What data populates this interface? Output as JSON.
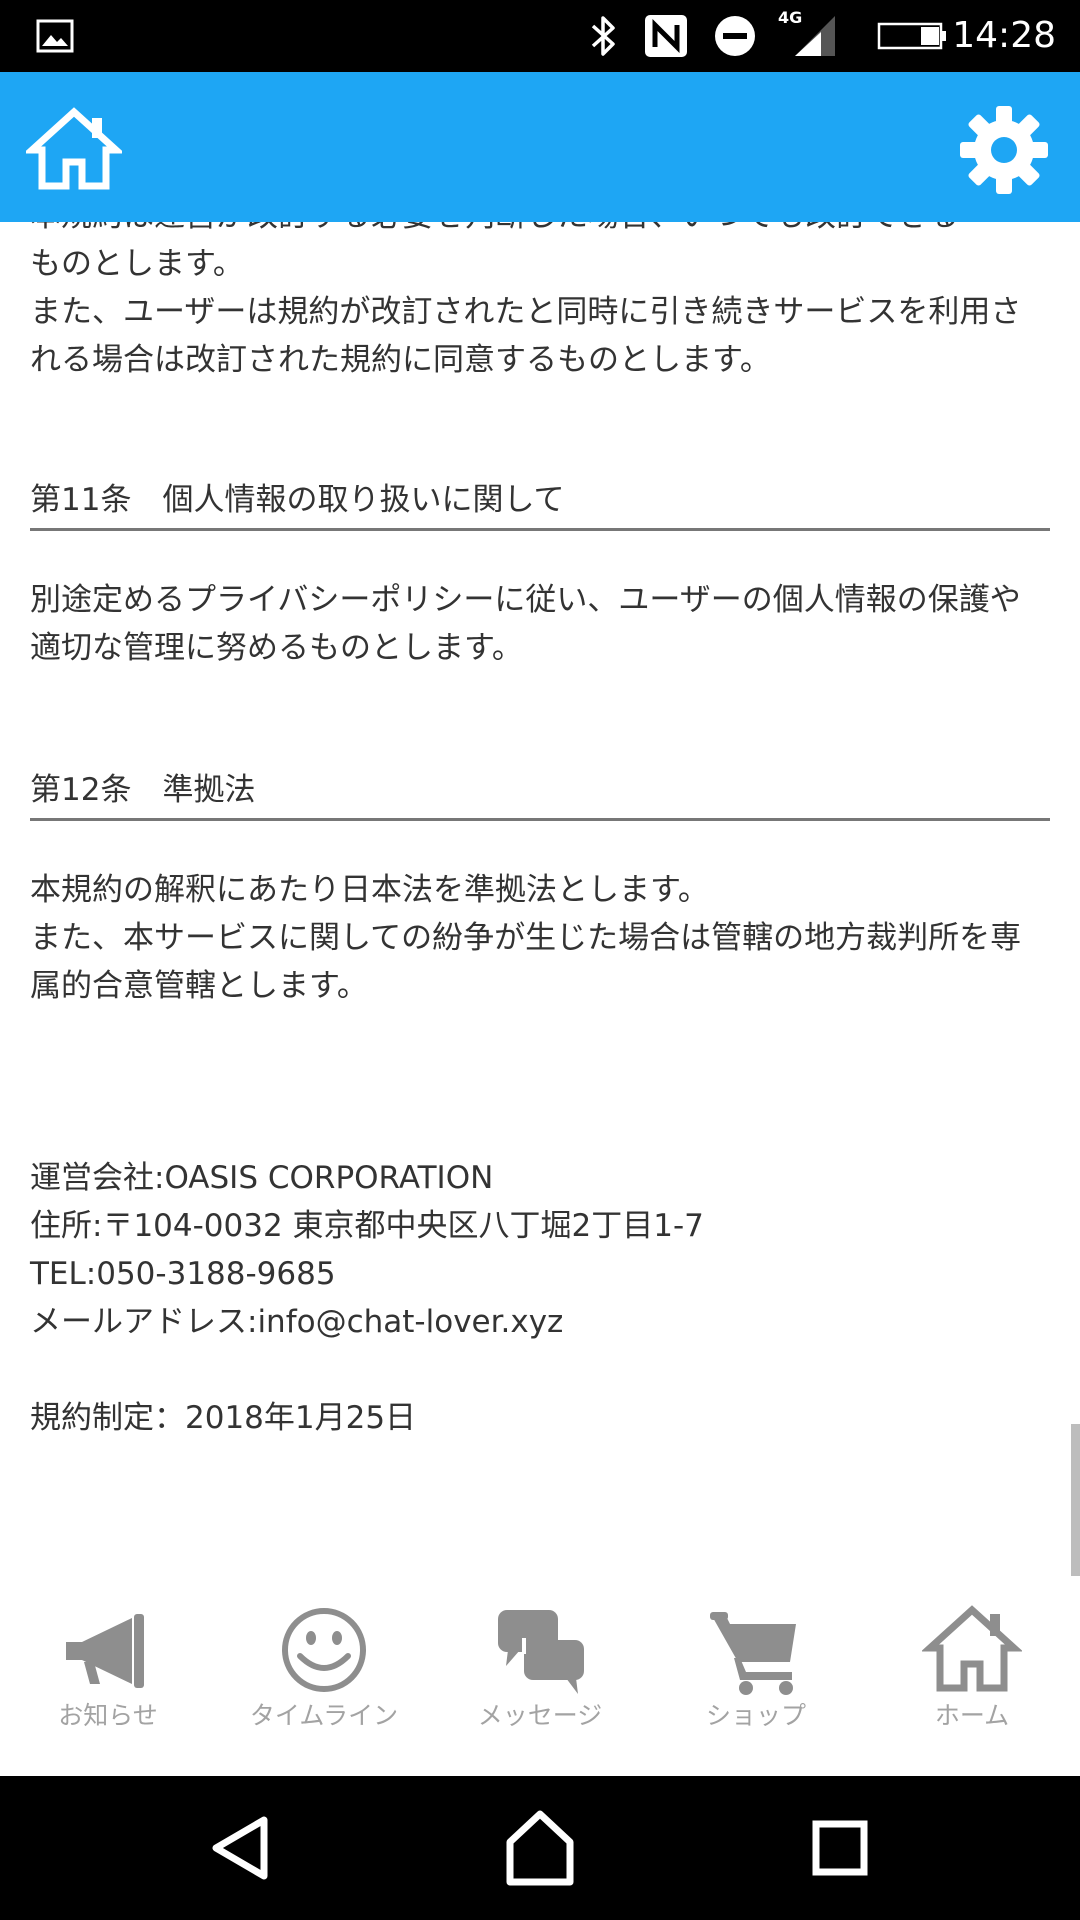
{
  "status_bar": {
    "time": "14:28",
    "network_label": "4G",
    "icons": [
      "image-icon",
      "bluetooth-icon",
      "nfc-icon",
      "do-not-disturb-icon",
      "signal-icon",
      "battery-icon"
    ]
  },
  "app_bar": {
    "background_color": "#1ea6f4",
    "left_icon": "home-icon",
    "right_icon": "gear-icon"
  },
  "content": {
    "cut_line": "本規約は運営が改訂する必要を判断した場合、いつでも改訂できる",
    "intro_paragraph": "ものとします。\nまた、ユーザーは規約が改訂されたと同時に引き続きサービスを利用される場合は改訂された規約に同意するものとします。",
    "article11": {
      "heading": "第11条　個人情報の取り扱いに関して",
      "body": "別途定めるプライバシーポリシーに従い、ユーザーの個人情報の保護や適切な管理に努めるものとします。"
    },
    "article12": {
      "heading": "第12条　準拠法",
      "body": "本規約の解釈にあたり日本法を準拠法とします。\nまた、本サービスに関しての紛争が生じた場合は管轄の地方裁判所を専属的合意管轄とします。"
    },
    "company_info": {
      "company": "運営会社:OASIS CORPORATION",
      "address": "住所:〒104-0032 東京都中央区八丁堀2丁目1-7",
      "tel": "TEL:050-3188-9685",
      "email": "メールアドレス:info@chat-lover.xyz"
    },
    "established": "規約制定：2018年1月25日"
  },
  "tab_bar": {
    "inactive_color": "#a3a3a3",
    "tabs": [
      {
        "label": "お知らせ",
        "icon": "megaphone-icon"
      },
      {
        "label": "タイムライン",
        "icon": "smiley-icon"
      },
      {
        "label": "メッセージ",
        "icon": "chat-bubbles-icon"
      },
      {
        "label": "ショップ",
        "icon": "shopping-cart-icon"
      },
      {
        "label": "ホーム",
        "icon": "home-icon"
      }
    ]
  },
  "nav_bar": {
    "buttons": [
      "back-icon",
      "home-icon",
      "recents-icon"
    ]
  }
}
